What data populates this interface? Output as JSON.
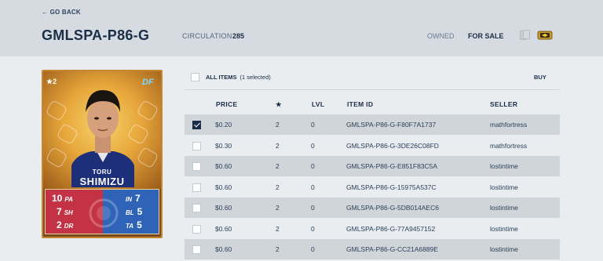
{
  "header": {
    "back_label": "← GO BACK",
    "title": "GMLSPA-P86-G",
    "circulation_label": "CIRCULATION",
    "circulation_value": "285",
    "owned_label": "OWNED",
    "for_sale_label": "FOR SALE"
  },
  "card": {
    "rank": "★2",
    "position": "DF",
    "first_name": "TORU",
    "last_name": "SHIMIZU",
    "stats": {
      "pa": {
        "value": "10",
        "label": "PA"
      },
      "sh": {
        "value": "7",
        "label": "SH"
      },
      "dr": {
        "value": "2",
        "label": "DR"
      },
      "in": {
        "value": "7",
        "label": "IN"
      },
      "bl": {
        "value": "5",
        "label": "BL"
      },
      "ta": {
        "value": "5",
        "label": "TA"
      }
    }
  },
  "list": {
    "all_items_label": "ALL ITEMS",
    "selected_text": "(1 selected)",
    "buy_label": "BUY",
    "columns": {
      "price": "PRICE",
      "stars": "★",
      "lvl": "LVL",
      "item_id": "ITEM ID",
      "seller": "SELLER"
    },
    "rows": [
      {
        "checked": true,
        "price": "$0.20",
        "stars": "2",
        "lvl": "0",
        "item_id": "GMLSPA-P86-G-F80F7A1737",
        "seller": "mathfortress"
      },
      {
        "checked": false,
        "price": "$0.30",
        "stars": "2",
        "lvl": "0",
        "item_id": "GMLSPA-P86-G-3DE26C08FD",
        "seller": "mathfortress"
      },
      {
        "checked": false,
        "price": "$0.60",
        "stars": "2",
        "lvl": "0",
        "item_id": "GMLSPA-P86-G-E851F83C5A",
        "seller": "lostintime"
      },
      {
        "checked": false,
        "price": "$0.60",
        "stars": "2",
        "lvl": "0",
        "item_id": "GMLSPA-P86-G-15975A537C",
        "seller": "lostintime"
      },
      {
        "checked": false,
        "price": "$0.60",
        "stars": "2",
        "lvl": "0",
        "item_id": "GMLSPA-P86-G-5DB014AEC6",
        "seller": "lostintime"
      },
      {
        "checked": false,
        "price": "$0.60",
        "stars": "2",
        "lvl": "0",
        "item_id": "GMLSPA-P86-G-77A9457152",
        "seller": "lostintime"
      },
      {
        "checked": false,
        "price": "$0.60",
        "stars": "2",
        "lvl": "0",
        "item_id": "GMLSPA-P86-G-CC21A6889E",
        "seller": "lostintime"
      }
    ]
  },
  "colors": {
    "header_bg": "#d5dbe0",
    "page_bg": "#e9edf0",
    "row_shade": "#d0d5da",
    "text_dark": "#1b2e48",
    "card_red": "#c43345",
    "card_blue": "#2e63b8",
    "card_gold": "#c6862f"
  },
  "icons": {
    "cards": "cards-icon",
    "pack": "pack-icon",
    "checkbox": "checkbox-icon"
  }
}
